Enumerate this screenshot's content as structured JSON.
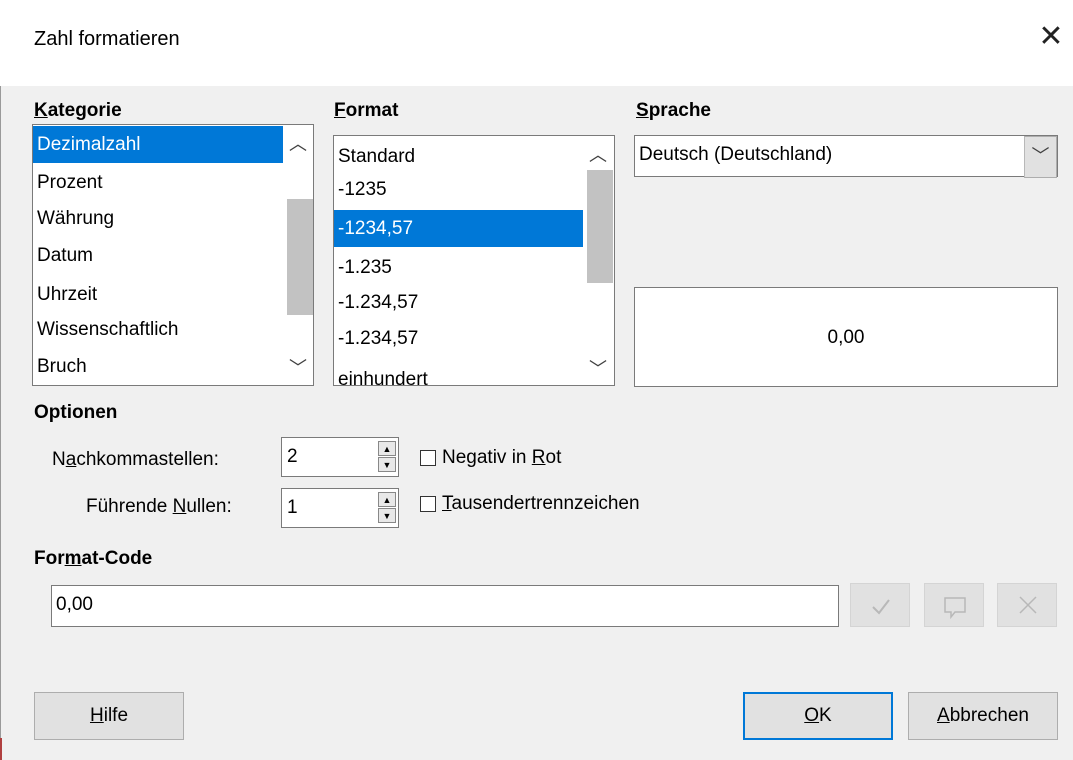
{
  "dialog": {
    "title": "Zahl formatieren"
  },
  "category": {
    "label_accel": "K",
    "label_rest": "ategorie",
    "items": [
      "Dezimalzahl",
      "Prozent",
      "Währung",
      "Datum",
      "Uhrzeit",
      "Wissenschaftlich",
      "Bruch"
    ],
    "selected": "Dezimalzahl"
  },
  "format": {
    "label_accel": "F",
    "label_rest": "ormat",
    "items": [
      "Standard",
      "-1235",
      "-1234,57",
      "-1.235",
      "-1.234,57",
      "-1.234,57",
      "einhundert"
    ],
    "selected": "-1234,57"
  },
  "language": {
    "label_accel": "S",
    "label_rest": "prache",
    "value": "Deutsch (Deutschland)"
  },
  "preview": {
    "value": "0,00"
  },
  "options": {
    "heading": "Optionen",
    "decimals": {
      "pre": "N",
      "accel": "a",
      "post": "chkommastellen:",
      "value": "2"
    },
    "leading_zeros": {
      "pre": "Führende ",
      "accel": "N",
      "post": "ullen:",
      "value": "1"
    },
    "negative_red": {
      "pre": "Negativ in ",
      "accel": "R",
      "post": "ot",
      "checked": false
    },
    "thousands": {
      "pre": "",
      "accel": "T",
      "post": "ausendertrennzeichen",
      "checked": false
    }
  },
  "format_code": {
    "pre": "For",
    "accel": "m",
    "post": "at-Code",
    "value": "0,00"
  },
  "buttons": {
    "help": {
      "accel": "H",
      "rest": "ilfe"
    },
    "ok": {
      "accel": "O",
      "rest": "K"
    },
    "cancel": {
      "accel": "A",
      "rest": "bbrechen"
    }
  },
  "icons": [
    "close-icon",
    "chevron-up-icon",
    "chevron-down-icon",
    "check-icon",
    "comment-icon",
    "delete-icon"
  ]
}
